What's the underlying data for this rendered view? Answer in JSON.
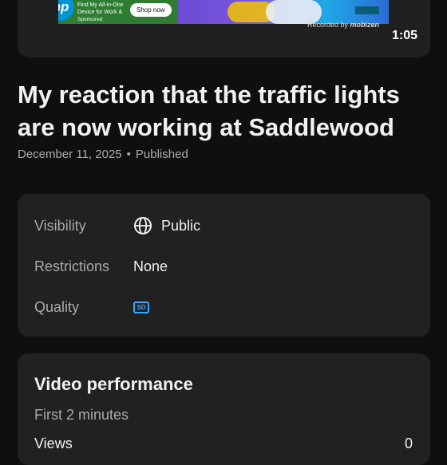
{
  "video": {
    "ad": {
      "brand": "hp",
      "headline_line1": "Find My All-in-One",
      "headline_line2": "Device for Work &",
      "sponsored": "Sponsored",
      "shop_button": "Shop now"
    },
    "recorded_by": "Recorded by",
    "recorder_brand": "mobizen",
    "duration": "1:05"
  },
  "title": "My reaction that the traffic lights are now working at Saddlewood",
  "meta": {
    "date": "December 11, 2025",
    "separator": "•",
    "status": "Published"
  },
  "details": {
    "visibility_label": "Visibility",
    "visibility_value": "Public",
    "visibility_icon": "globe-icon",
    "restrictions_label": "Restrictions",
    "restrictions_value": "None",
    "quality_label": "Quality",
    "quality_badge": "SD",
    "accent_color": "#3ea6ff"
  },
  "performance": {
    "title": "Video performance",
    "subtitle": "First 2 minutes",
    "views_label": "Views",
    "views_value": "0"
  }
}
